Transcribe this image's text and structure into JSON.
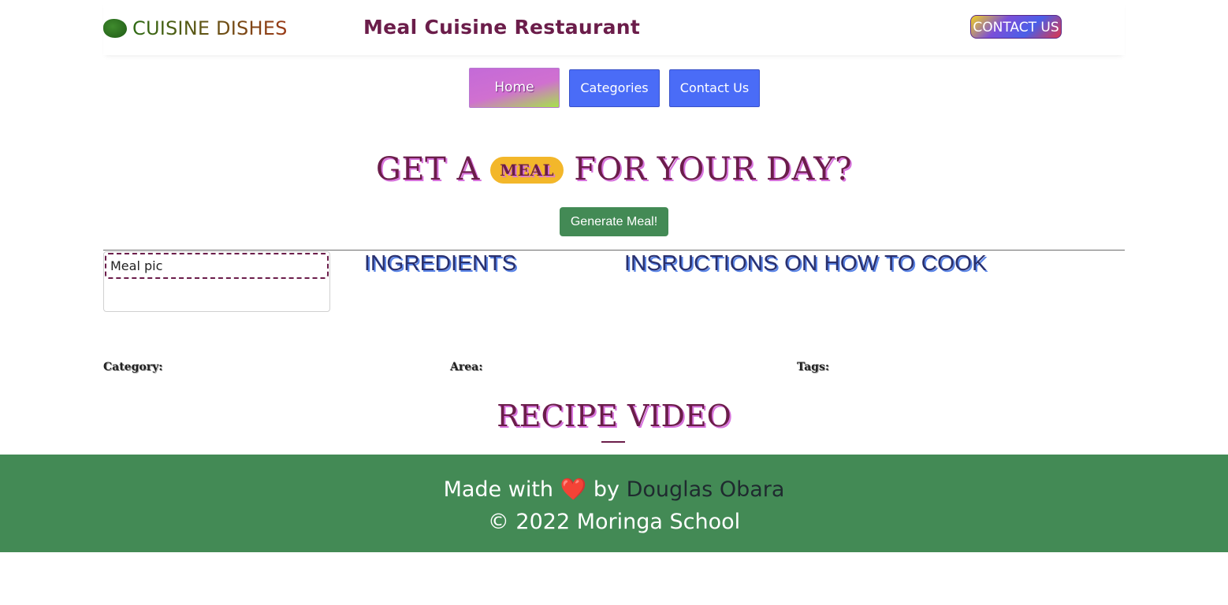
{
  "header": {
    "brand": "CUISINE DISHES",
    "title": "Meal Cuisine Restaurant",
    "contact_button": "CONTACT US"
  },
  "nav": {
    "items": [
      "Home",
      "Categories",
      "Contact Us"
    ]
  },
  "hero": {
    "before": "GET A",
    "pill": "MEAL",
    "after": "FOR YOUR DAY?"
  },
  "generate_button": "Generate Meal!",
  "meal": {
    "image_alt": "Meal pic",
    "ingredients_heading": "INGREDIENTS",
    "instructions_heading": "INSRUCTIONS ON HOW TO COOK",
    "category_label": "Category:",
    "area_label": "Area:",
    "tags_label": "Tags:"
  },
  "video_heading": "RECIPE VIDEO",
  "footer": {
    "made_with": "Made with",
    "heart": "❤️",
    "by": "by",
    "author": "Douglas Obara",
    "copyright": "© 2022 Moringa School"
  },
  "colors": {
    "footer_bg": "#438a55",
    "nav_button": "#4a6cf7",
    "primary_text": "#6b1d4a"
  }
}
